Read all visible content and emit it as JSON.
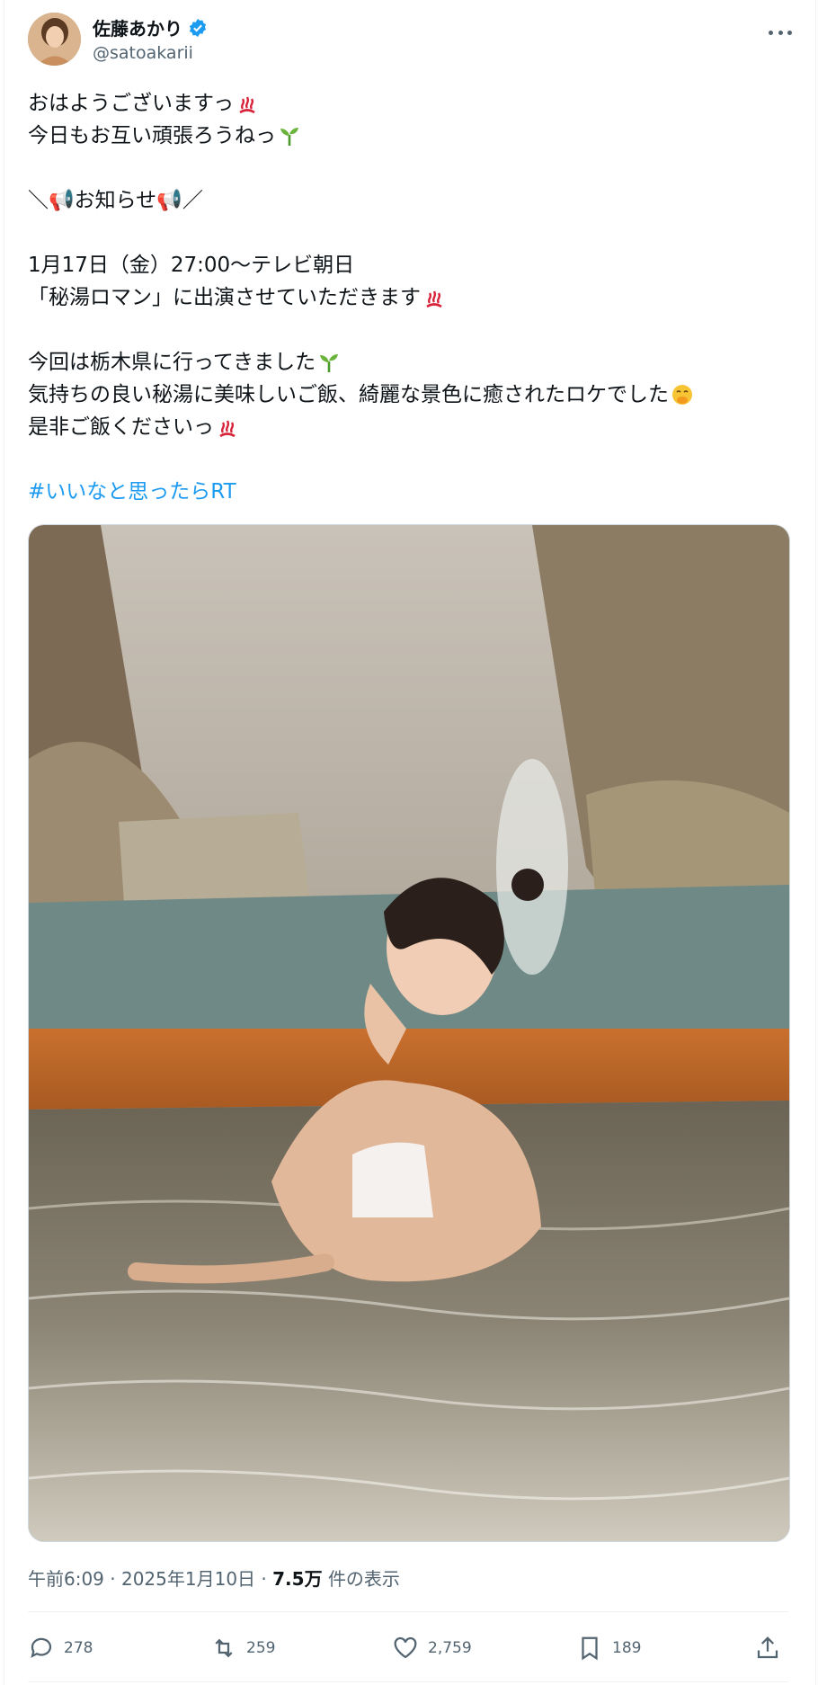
{
  "post": {
    "author": {
      "name": "佐藤あかり",
      "handle": "@satoakarii",
      "verified": true,
      "avatar_icon": "profile-photo"
    },
    "more_icon": "more-dots-icon",
    "text_lines": [
      {
        "text": "おはようございますっ",
        "emoji": "hot-springs"
      },
      {
        "text": "今日もお互い頑張ろうねっ",
        "emoji": "seedling"
      },
      {
        "text": ""
      },
      {
        "text": "＼📢お知らせ📢／"
      },
      {
        "text": ""
      },
      {
        "text": "1月17日（金）27:00〜テレビ朝日"
      },
      {
        "text": "「秘湯ロマン」に出演させていただきます",
        "emoji": "hot-springs"
      },
      {
        "text": ""
      },
      {
        "text": "今回は栃木県に行ってきました",
        "emoji": "seedling"
      },
      {
        "text": "気持ちの良い秘湯に美味しいご飯、綺麗な景色に癒されたロケでした",
        "emoji": "face-with-hand-over-mouth"
      },
      {
        "text": "是非ご飯くださいっ",
        "emoji": "hot-springs"
      },
      {
        "text": ""
      }
    ],
    "hashtag": "#いいなと思ったらRT",
    "image_description_icon": "photo-hot-spring",
    "timestamp": "午前6:09 · 2025年1月10日 ·",
    "views_count": "7.5万",
    "views_label": "件の表示",
    "actions": {
      "reply": {
        "icon": "reply-icon",
        "count": "278"
      },
      "repost": {
        "icon": "repost-icon",
        "count": "259"
      },
      "like": {
        "icon": "heart-icon",
        "count": "2,759"
      },
      "bookmark": {
        "icon": "bookmark-icon",
        "count": "189"
      },
      "share": {
        "icon": "share-icon"
      }
    },
    "colors": {
      "accent": "#1d9bf0",
      "text": "#0f1419",
      "secondary": "#536471"
    }
  }
}
